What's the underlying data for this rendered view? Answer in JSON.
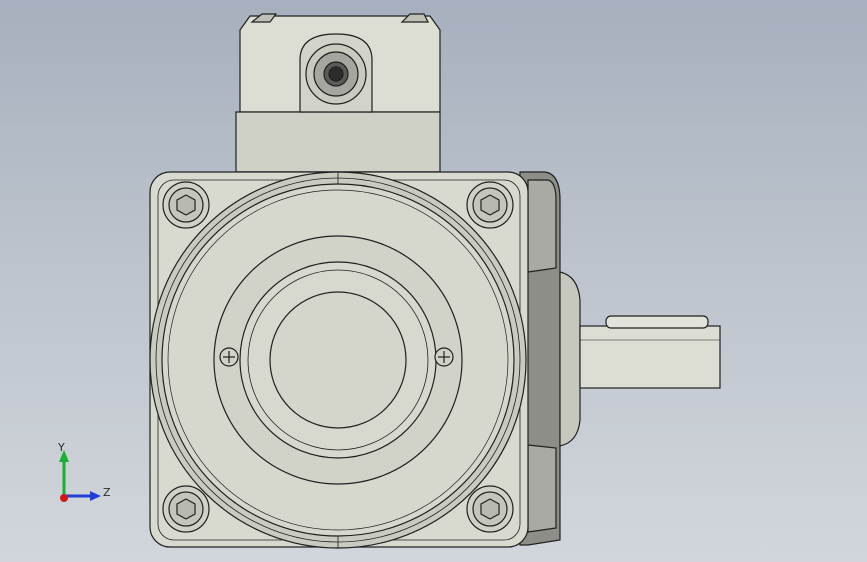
{
  "triad": {
    "x_label": "",
    "y_label": "Y",
    "z_label": "Z",
    "colors": {
      "x": "#d01818",
      "y": "#18b030",
      "z": "#2040d8"
    }
  },
  "model": {
    "body_color": "#d8d9cf",
    "shade_color": "#c7c8bd",
    "dark_shade": "#8d8e88",
    "edge_color": "#202020",
    "icons": [
      "hex-socket-bolt-icon",
      "phillips-screw-icon",
      "keyed-shaft-icon"
    ]
  }
}
